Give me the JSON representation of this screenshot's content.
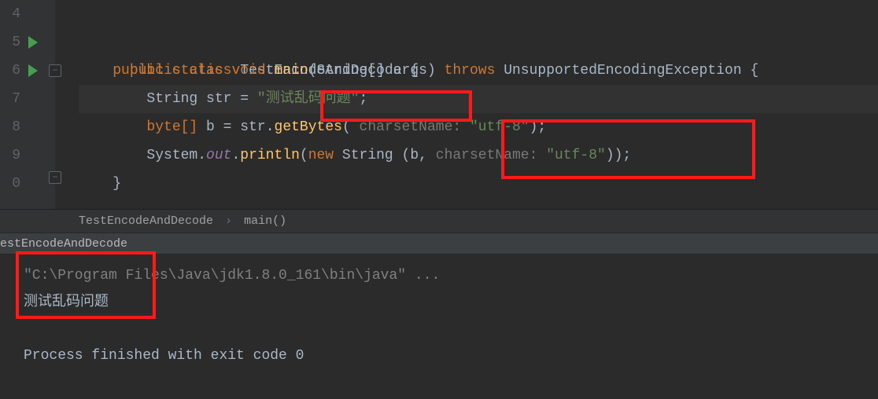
{
  "editor": {
    "line_numbers": [
      "4",
      "5",
      "6",
      "7",
      "8",
      "9",
      "0"
    ],
    "code": {
      "l5": {
        "kw_public": "public",
        "kw_class": "class",
        "class_name": "TestEncodeAndDecode",
        "brace": "{"
      },
      "l6": {
        "kw_public": "public",
        "kw_static": "static",
        "kw_void": "void",
        "method": "main",
        "args": "(String[] args)",
        "kw_throws": "throws",
        "exception": "UnsupportedEncodingException",
        "brace": "{"
      },
      "l7": {
        "type": "String",
        "var": "str",
        "eq": "=",
        "string_literal": "\"测试乱码问题\"",
        "semi": ";"
      },
      "l8": {
        "type": "byte[]",
        "var": "b",
        "eq": "=",
        "call1": "str.",
        "method1": "getBytes",
        "hint": "charsetName:",
        "arg": "\"utf-8\"",
        "close": ");"
      },
      "l9": {
        "obj": "System.",
        "field": "out",
        "dot": ".",
        "method": "println",
        "kw_new": "new",
        "ctor": "String",
        "args1": "(b, ",
        "hint": "charsetName:",
        "arg": "\"utf-8\"",
        "close": "));"
      },
      "l10": {
        "brace": "}"
      }
    }
  },
  "breadcrumb": {
    "class": "TestEncodeAndDecode",
    "method": "main()"
  },
  "run_config": "estEncodeAndDecode",
  "console": {
    "command": "\"C:\\Program Files\\Java\\jdk1.8.0_161\\bin\\java\" ...",
    "output": "测试乱码问题",
    "exit": "Process finished with exit code 0"
  }
}
